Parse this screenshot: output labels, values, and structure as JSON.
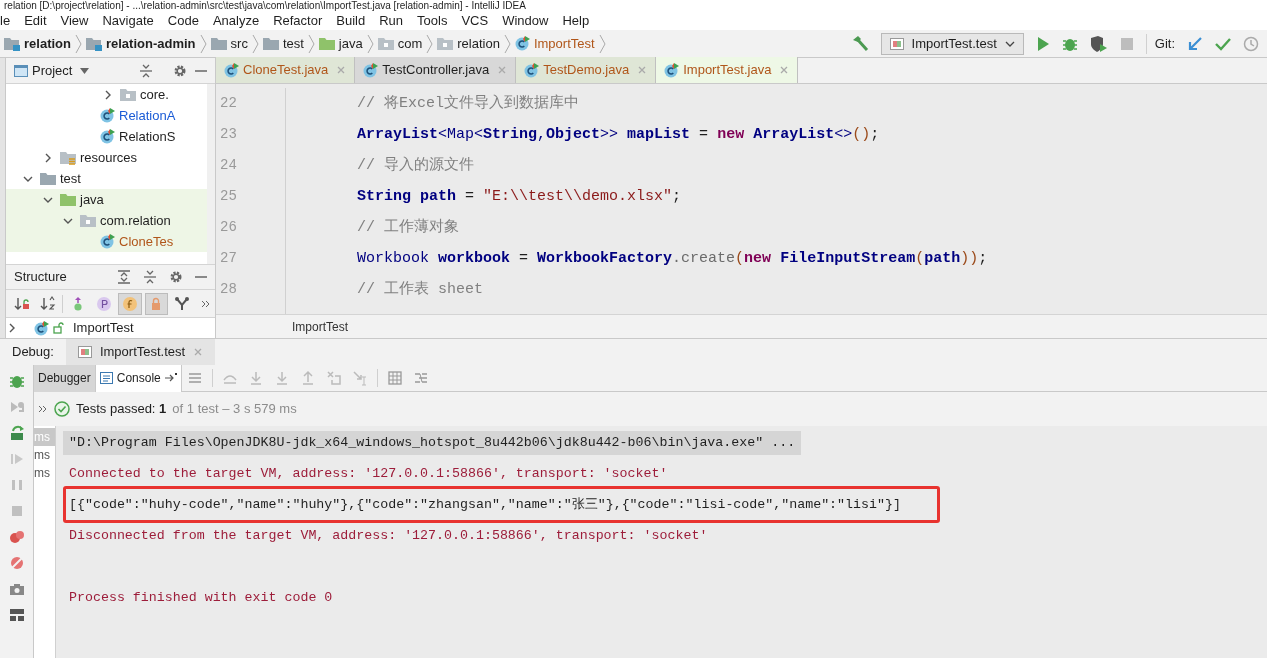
{
  "window": {
    "title": "relation [D:\\project\\relation] - ...\\relation-admin\\src\\test\\java\\com\\relation\\ImportTest.java [relation-admin] - IntelliJ IDEA"
  },
  "menu": [
    "le",
    "Edit",
    "View",
    "Navigate",
    "Code",
    "Analyze",
    "Refactor",
    "Build",
    "Run",
    "Tools",
    "VCS",
    "Window",
    "Help"
  ],
  "breadcrumbs": [
    {
      "label": "relation",
      "kind": "module"
    },
    {
      "label": "relation-admin",
      "kind": "module"
    },
    {
      "label": "src",
      "kind": "folder"
    },
    {
      "label": "test",
      "kind": "folder"
    },
    {
      "label": "java",
      "kind": "source-folder"
    },
    {
      "label": "com",
      "kind": "package"
    },
    {
      "label": "relation",
      "kind": "package"
    },
    {
      "label": "ImportTest",
      "kind": "class"
    }
  ],
  "run_config": "ImportTest.test",
  "git_label": "Git:",
  "project_panel": {
    "title": "Project",
    "tree": [
      {
        "children": [
          {
            "children": [
              {
                "children": [
                  {
                    "children": [
                      {
                        "label": "core.",
                        "kind": "package",
                        "expanded": false,
                        "test_scope": false
                      }
                    ]
                  },
                  {
                    "label": "RelationA",
                    "kind": "class",
                    "color": "#1a5bd6",
                    "test_scope": false
                  },
                  {
                    "label": "RelationS",
                    "kind": "class",
                    "color": "#1f1f1f",
                    "test_scope": false
                  }
                ]
              }
            ]
          },
          {
            "label": "resources",
            "kind": "resources",
            "expanded": false,
            "test_scope": false
          }
        ]
      },
      {
        "label": "test",
        "kind": "folder",
        "expanded": true,
        "test_scope": false,
        "children": [
          {
            "label": "java",
            "kind": "source-folder",
            "expanded": true,
            "test_scope": true,
            "children": [
              {
                "label": "com.relation",
                "kind": "package",
                "expanded": true,
                "test_scope": true,
                "children": [
                  {
                    "label": "CloneTes",
                    "kind": "class",
                    "color": "#b0561a",
                    "test_scope": true
                  }
                ]
              }
            ]
          }
        ]
      }
    ]
  },
  "structure_panel": {
    "title": "Structure",
    "toggles": [
      {
        "kind": "sort-visibility",
        "on": false
      },
      {
        "kind": "sort-alpha",
        "on": false
      },
      {
        "kind": "inherited",
        "on": false
      },
      {
        "kind": "properties",
        "on": false
      },
      {
        "kind": "fields",
        "on": true
      },
      {
        "kind": "non-public",
        "on": true
      },
      {
        "kind": "anonymous",
        "on": false
      }
    ],
    "tree": [
      {
        "label": "ImportTest",
        "expanded": false
      }
    ]
  },
  "editor_tabs": [
    {
      "label": "CloneTest.java",
      "selected": false,
      "color": "#b0561a",
      "test_scope": true
    },
    {
      "label": "TestController.java",
      "selected": false,
      "color": "#1f1f1f",
      "test_scope": false
    },
    {
      "label": "TestDemo.java",
      "selected": false,
      "color": "#b0561a",
      "test_scope": true
    },
    {
      "label": "ImportTest.java",
      "selected": true,
      "color": "#b0561a",
      "test_scope": true
    }
  ],
  "code_lines": [
    {
      "number": "22",
      "tokens": [
        {
          "text": "// 将Excel文件导入到数据库中",
          "kind": "comment"
        }
      ]
    },
    {
      "number": "23",
      "tokens": [
        {
          "text": "ArrayList",
          "kind": "bold"
        },
        {
          "text": "<Map<",
          "kind": "name"
        },
        {
          "text": "String",
          "kind": "bold"
        },
        {
          "text": ",",
          "kind": "name"
        },
        {
          "text": "Object",
          "kind": "bold"
        },
        {
          "text": ">> ",
          "kind": "name"
        },
        {
          "text": "mapList",
          "kind": "bold"
        },
        {
          "text": " = ",
          "kind": "punct"
        },
        {
          "text": "new",
          "kind": "keyword"
        },
        {
          "text": " ArrayList",
          "kind": "bold"
        },
        {
          "text": "<>",
          "kind": "name"
        },
        {
          "text": "()",
          "kind": "paren"
        },
        {
          "text": ";",
          "kind": "punct"
        }
      ]
    },
    {
      "number": "24",
      "tokens": [
        {
          "text": "// 导入的源文件",
          "kind": "comment"
        }
      ]
    },
    {
      "number": "25",
      "tokens": [
        {
          "text": "String path",
          "kind": "bold"
        },
        {
          "text": " = ",
          "kind": "punct"
        },
        {
          "text": "\"E:\\\\test\\\\demo.xlsx\"",
          "kind": "string"
        },
        {
          "text": ";",
          "kind": "punct"
        }
      ]
    },
    {
      "number": "26",
      "tokens": [
        {
          "text": "// 工作薄对象",
          "kind": "comment"
        }
      ]
    },
    {
      "number": "27",
      "tokens": [
        {
          "text": "Workbook ",
          "kind": "name"
        },
        {
          "text": "workbook",
          "kind": "bold"
        },
        {
          "text": " = ",
          "kind": "punct"
        },
        {
          "text": "WorkbookFactory",
          "kind": "bold"
        },
        {
          "text": ".create",
          "kind": "method"
        },
        {
          "text": "(",
          "kind": "paren"
        },
        {
          "text": "new",
          "kind": "keyword"
        },
        {
          "text": " FileInputStream",
          "kind": "bold"
        },
        {
          "text": "(",
          "kind": "paren"
        },
        {
          "text": "path",
          "kind": "bold"
        },
        {
          "text": "))",
          "kind": "paren"
        },
        {
          "text": ";",
          "kind": "punct"
        }
      ]
    },
    {
      "number": "28",
      "tokens": [
        {
          "text": "// 工作表 sheet",
          "kind": "comment"
        }
      ]
    }
  ],
  "editor_breadcrumb": "ImportTest",
  "debug": {
    "label": "Debug:",
    "tab": "ImportTest.test",
    "subtabs": [
      {
        "label": "Debugger",
        "selected": false
      },
      {
        "label": "Console",
        "selected": true
      }
    ],
    "test_summary": "Tests passed: **1**",
    "test_detail": "of 1 test – 3 s 579 ms",
    "test_times": [
      {
        "label": "ms",
        "selected": true
      },
      {
        "label": "ms",
        "selected": false
      },
      {
        "label": "ms",
        "selected": false
      }
    ],
    "console": [
      {
        "kind": "command",
        "text": "\"D:\\Program Files\\OpenJDK8U-jdk_x64_windows_hotspot_8u442b06\\jdk8u442-b06\\bin\\java.exe\" ..."
      },
      {
        "kind": "system",
        "text": "Connected to the target VM, address: '127.0.0.1:58866', transport: 'socket'"
      },
      {
        "kind": "output",
        "text": "[{\"code\":\"huhy-code\",\"name\":\"huhy\"},{\"code\":\"zhangsan\",\"name\":\"张三\"},{\"code\":\"lisi-code\",\"name\":\"lisi\"}]",
        "annotated": true
      },
      {
        "kind": "system",
        "text": "Disconnected from the target VM, address: '127.0.0.1:58866', transport: 'socket'"
      },
      {
        "kind": "blank"
      },
      {
        "kind": "system",
        "text": "Process finished with exit code 0"
      }
    ]
  }
}
